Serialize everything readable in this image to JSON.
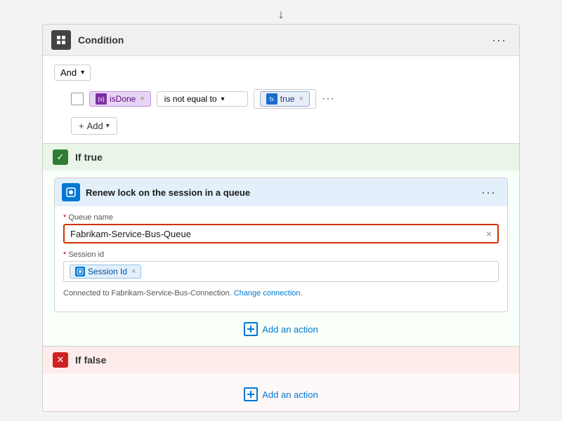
{
  "arrow": "↓",
  "condition": {
    "title": "Condition",
    "icon": "⊞",
    "ellipsis": "···",
    "and_label": "And",
    "tag_isdone": "isDone",
    "operator": "is not equal to",
    "tag_true": "true",
    "add_label": "Add"
  },
  "if_true": {
    "title": "If true",
    "action": {
      "title": "Renew lock on the session in a queue",
      "ellipsis": "···",
      "queue_label": "* Queue name",
      "queue_value": "Fabrikam-Service-Bus-Queue",
      "session_label": "* Session id",
      "session_tag": "Session Id",
      "connection_text": "Connected to Fabrikam-Service-Bus-Connection.",
      "change_connection": "Change connection."
    },
    "add_action_label": "Add an action"
  },
  "if_false": {
    "title": "If false",
    "add_action_label": "Add an action"
  }
}
